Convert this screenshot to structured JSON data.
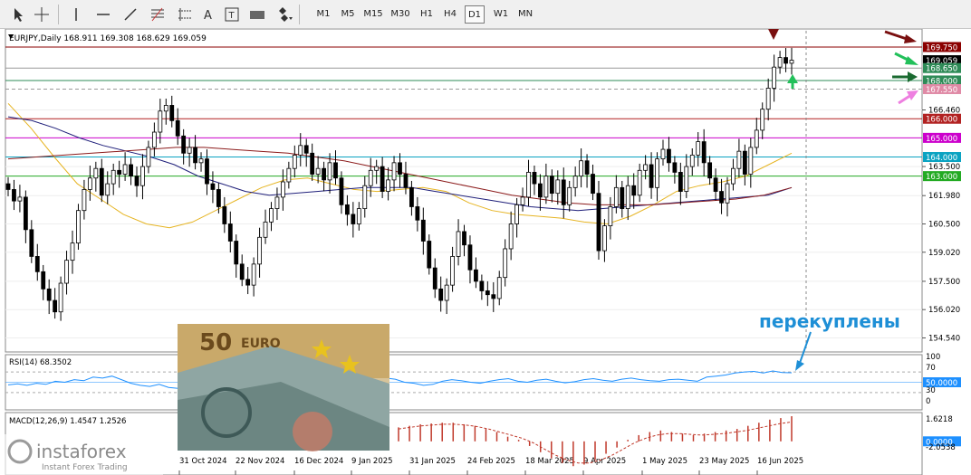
{
  "toolbar": {
    "tools": [
      {
        "name": "cursor-icon",
        "x": 10
      },
      {
        "name": "crosshair-icon",
        "x": 36
      },
      {
        "name": "vertical-line-icon",
        "x": 74
      },
      {
        "name": "horizontal-line-icon",
        "x": 104
      },
      {
        "name": "trendline-icon",
        "x": 134
      },
      {
        "name": "fibonacci-icon",
        "x": 164
      },
      {
        "name": "channel-icon",
        "x": 194
      },
      {
        "name": "text-icon",
        "x": 220
      },
      {
        "name": "label-icon",
        "x": 246
      },
      {
        "name": "rectangle-icon",
        "x": 274
      },
      {
        "name": "shapes-icon",
        "x": 304
      }
    ],
    "timeframes": [
      "M1",
      "M5",
      "M15",
      "M30",
      "H1",
      "H4",
      "D1",
      "W1",
      "MN"
    ],
    "active_timeframe": "D1"
  },
  "chart_data": {
    "type": "candlestick",
    "title": "EURJPY,Daily  168.911 169.308 168.629 169.059",
    "y_ticks": [
      166.46,
      163.5,
      161.98,
      160.5,
      159.02,
      157.5,
      156.02,
      154.54
    ],
    "ylim": [
      153.9,
      170.6
    ],
    "x_labels": [
      "31 Oct 2024",
      "22 Nov 2024",
      "16 Dec 2024",
      "9 Jan 2025",
      "31 Jan 2025",
      "24 Feb 2025",
      "18 Mar 2025",
      "9 Apr 2025",
      "1 May 2025",
      "23 May 2025",
      "16 Jun 2025"
    ],
    "price_badges": [
      {
        "price": 169.75,
        "text": "169.750",
        "color": "#8b0000"
      },
      {
        "price": 169.06,
        "text": "169.059",
        "color": "#000000"
      },
      {
        "price": 168.65,
        "text": "168.650",
        "color": "#2e8b57"
      },
      {
        "price": 168.0,
        "text": "168.000",
        "color": "#2e8b57"
      },
      {
        "price": 167.55,
        "text": "167.550",
        "color": "#e08aa6"
      },
      {
        "price": 166.0,
        "text": "166.000",
        "color": "#b22222"
      },
      {
        "price": 165.0,
        "text": "165.000",
        "color": "#cc00cc"
      },
      {
        "price": 164.0,
        "text": "164.000",
        "color": "#0aa3c2"
      },
      {
        "price": 163.0,
        "text": "163.000",
        "color": "#22aa22"
      }
    ],
    "levels": [
      {
        "price": 169.75,
        "color": "#8b0000",
        "style": "solid"
      },
      {
        "price": 168.65,
        "color": "#999999",
        "style": "solid"
      },
      {
        "price": 168.0,
        "color": "#2e8b57",
        "style": "solid"
      },
      {
        "price": 167.55,
        "color": "#999999",
        "style": "dash"
      },
      {
        "price": 166.0,
        "color": "#b22222",
        "style": "solid"
      },
      {
        "price": 165.0,
        "color": "#cc00cc",
        "style": "solid"
      },
      {
        "price": 164.0,
        "color": "#0aa3c2",
        "style": "solid"
      },
      {
        "price": 163.0,
        "color": "#22aa22",
        "style": "solid"
      }
    ],
    "closes": [
      162.3,
      161.7,
      161.9,
      160.2,
      158.8,
      158.0,
      157.1,
      156.5,
      155.9,
      157.4,
      158.6,
      159.5,
      161.2,
      162.3,
      162.9,
      163.4,
      162.0,
      162.6,
      163.3,
      163.1,
      163.6,
      163.0,
      162.5,
      163.5,
      164.5,
      165.3,
      166.4,
      166.7,
      165.9,
      165.1,
      164.2,
      164.5,
      163.7,
      163.9,
      162.6,
      162.3,
      161.4,
      160.5,
      159.6,
      158.4,
      157.6,
      157.3,
      158.4,
      159.8,
      160.6,
      161.3,
      161.9,
      162.7,
      163.4,
      164.1,
      164.6,
      164.2,
      163.1,
      163.4,
      162.8,
      163.7,
      162.9,
      161.5,
      161.0,
      160.5,
      161.3,
      162.5,
      163.3,
      163.5,
      162.2,
      162.8,
      163.7,
      163.1,
      162.4,
      161.4,
      160.7,
      159.6,
      158.2,
      157.1,
      156.5,
      157.3,
      158.8,
      160.1,
      159.4,
      158.1,
      157.5,
      157.0,
      156.8,
      156.6,
      157.7,
      159.2,
      160.5,
      161.5,
      161.9,
      163.2,
      162.6,
      161.9,
      163.0,
      162.1,
      162.8,
      161.5,
      162.4,
      163.0,
      163.8,
      163.1,
      162.1,
      159.1,
      160.4,
      161.4,
      162.4,
      161.3,
      162.5,
      162.0,
      163.3,
      163.6,
      162.4,
      163.9,
      164.4,
      163.7,
      163.2,
      162.2,
      163.5,
      164.1,
      164.8,
      163.7,
      162.9,
      162.2,
      161.6,
      162.6,
      163.4,
      164.3,
      163.1,
      164.5,
      165.4,
      166.5,
      167.6,
      168.7,
      169.2,
      168.9,
      169.06
    ],
    "series": [
      {
        "name": "",
        "color": "#e6b422",
        "values": [
          166.8,
          165.5,
          164.0,
          162.6,
          161.8,
          161.0,
          160.5,
          160.3,
          160.6,
          161.2,
          161.8,
          162.4,
          162.8,
          162.9,
          162.6,
          162.3,
          162.2,
          162.3,
          162.4,
          162.2,
          161.6,
          161.2,
          161.0,
          160.9,
          160.8,
          160.6,
          160.5,
          160.9,
          161.5,
          162.2,
          162.5,
          162.7,
          163.0,
          163.6,
          164.2
        ]
      },
      {
        "name": "",
        "color": "#1f1f7a",
        "values": [
          166.1,
          165.9,
          165.5,
          165.0,
          164.6,
          164.3,
          164.0,
          163.6,
          163.0,
          162.6,
          162.2,
          162.0,
          162.1,
          162.2,
          162.3,
          162.4,
          162.4,
          162.4,
          162.2,
          162.0,
          161.8,
          161.6,
          161.4,
          161.3,
          161.2,
          161.3,
          161.4,
          161.5,
          161.6,
          161.7,
          161.8,
          161.9,
          162.0,
          162.4
        ]
      },
      {
        "name": "",
        "color": "#8b1a1a",
        "values": [
          163.9,
          164.0,
          164.1,
          164.2,
          164.3,
          164.4,
          164.5,
          164.5,
          164.4,
          164.3,
          164.2,
          164.0,
          163.8,
          163.5,
          163.2,
          162.9,
          162.6,
          162.3,
          162.0,
          161.8,
          161.6,
          161.5,
          161.5,
          161.5,
          161.6,
          161.7,
          161.8,
          162.0,
          162.4
        ]
      }
    ],
    "annotation": "перекуплены",
    "rsi": {
      "title": "RSI(14) 68.3502",
      "ticks": [
        "100",
        "70",
        "50.0000",
        "30",
        "0"
      ],
      "values": [
        45,
        47,
        44,
        48,
        46,
        52,
        50,
        55,
        53,
        60,
        58,
        62,
        55,
        48,
        44,
        42,
        46,
        40,
        38,
        44,
        50,
        52,
        55,
        58,
        54,
        50,
        48,
        46,
        44,
        47,
        50,
        53,
        51,
        49,
        55,
        52,
        48,
        46,
        50,
        54,
        58,
        56,
        50,
        48,
        44,
        46,
        52,
        55,
        53,
        50,
        48,
        52,
        55,
        57,
        52,
        50,
        54,
        56,
        52,
        49,
        51,
        55,
        57,
        54,
        52,
        56,
        58,
        55,
        53,
        52,
        55,
        56,
        54,
        52,
        60,
        62,
        64,
        68,
        70,
        71,
        68,
        72,
        69,
        68.4
      ]
    },
    "macd": {
      "title": "MACD(12,26,9) 1.4547 1.2526",
      "ticks": [
        "1.6218",
        "0.0000",
        "-2.0538"
      ],
      "hist": [
        0.9,
        1.0,
        1.1,
        1.15,
        1.2,
        1.2,
        1.1,
        1.0,
        0.8,
        0.6,
        0.3,
        0.1,
        -0.3,
        -0.7,
        -1.1,
        -1.4,
        -1.6,
        -1.5,
        -1.2,
        -0.8,
        -0.4,
        0.1,
        0.4,
        0.6,
        0.7,
        0.6,
        0.5,
        0.4,
        0.5,
        0.6,
        0.7,
        0.8,
        1.0,
        1.2,
        1.4,
        1.5,
        1.62
      ],
      "signal": [
        0.8,
        0.9,
        1.0,
        1.05,
        1.1,
        1.1,
        1.05,
        0.95,
        0.8,
        0.6,
        0.4,
        0.2,
        -0.1,
        -0.5,
        -0.9,
        -1.2,
        -1.4,
        -1.4,
        -1.2,
        -0.9,
        -0.5,
        -0.1,
        0.2,
        0.4,
        0.5,
        0.5,
        0.45,
        0.4,
        0.45,
        0.5,
        0.6,
        0.7,
        0.85,
        1.0,
        1.15,
        1.25
      ]
    }
  },
  "branding": {
    "logo_text": "instaforex",
    "tagline": "Instant Forex Trading"
  },
  "banknote": {
    "value": "50",
    "currency": "EURO"
  },
  "colors": {
    "bull": "#ffffff",
    "bear": "#000000",
    "rsi_line": "#1e90ff",
    "macd_hist": "#c0392b",
    "macd_signal": "#c0392b",
    "annotation": "#1e8fd6"
  }
}
